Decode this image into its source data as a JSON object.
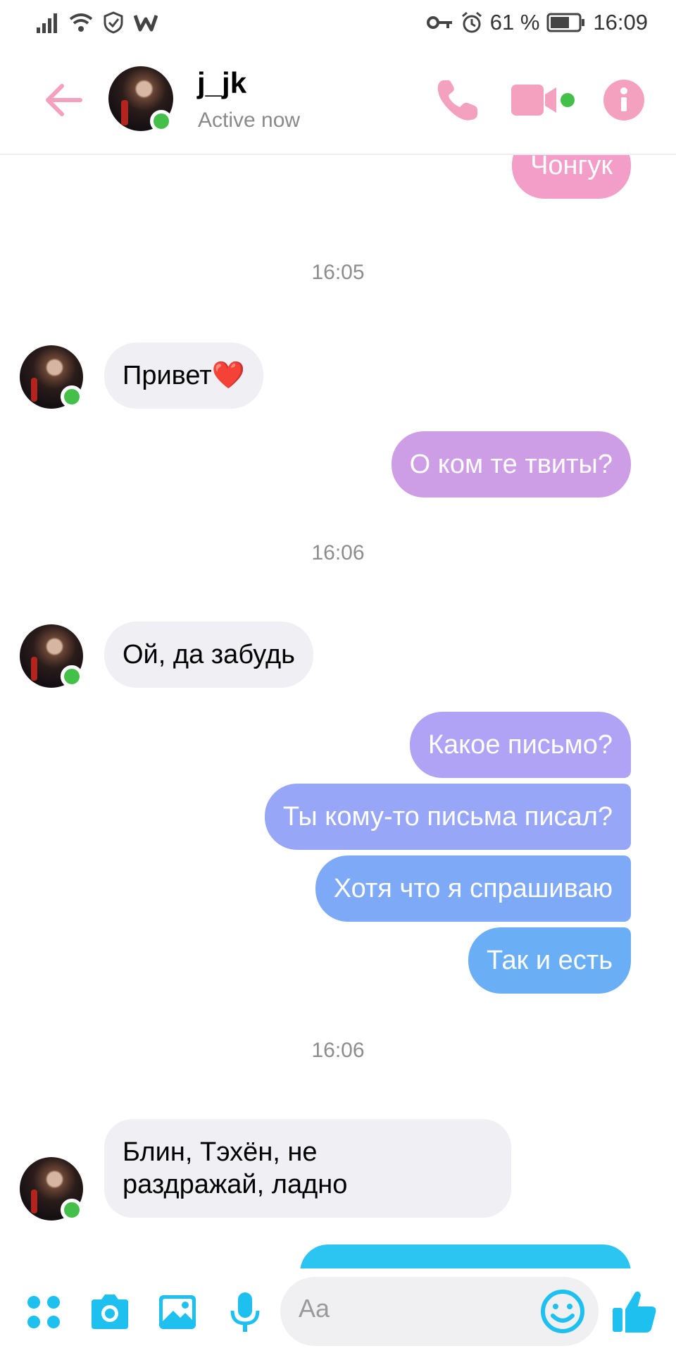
{
  "status_bar": {
    "battery_percent": "61 %",
    "time": "16:09"
  },
  "header": {
    "contact_name": "j_jk",
    "contact_status": "Active now"
  },
  "chat": {
    "items": [
      {
        "type": "outgoing",
        "text": "Чонгук"
      },
      {
        "type": "timestamp",
        "text": "16:05"
      },
      {
        "type": "incoming",
        "text": "Привет❤️"
      },
      {
        "type": "outgoing",
        "text": "О ком те твиты?"
      },
      {
        "type": "timestamp",
        "text": "16:06"
      },
      {
        "type": "incoming",
        "text": "Ой, да забудь"
      },
      {
        "type": "outgoing",
        "text": "Какое письмо?"
      },
      {
        "type": "outgoing",
        "text": "Ты кому-то письма писал?"
      },
      {
        "type": "outgoing",
        "text": "Хотя что я спрашиваю"
      },
      {
        "type": "outgoing",
        "text": "Так и есть"
      },
      {
        "type": "timestamp",
        "text": "16:06"
      },
      {
        "type": "incoming",
        "line1": "Блин, Тэхён, не",
        "line2": "раздражай, ладно"
      }
    ]
  },
  "composer": {
    "placeholder": "Aa"
  },
  "colors": {
    "accent_pink": "#f4a0bf",
    "online_green": "#44c04a",
    "composer_blue": "#1ec0ef"
  }
}
